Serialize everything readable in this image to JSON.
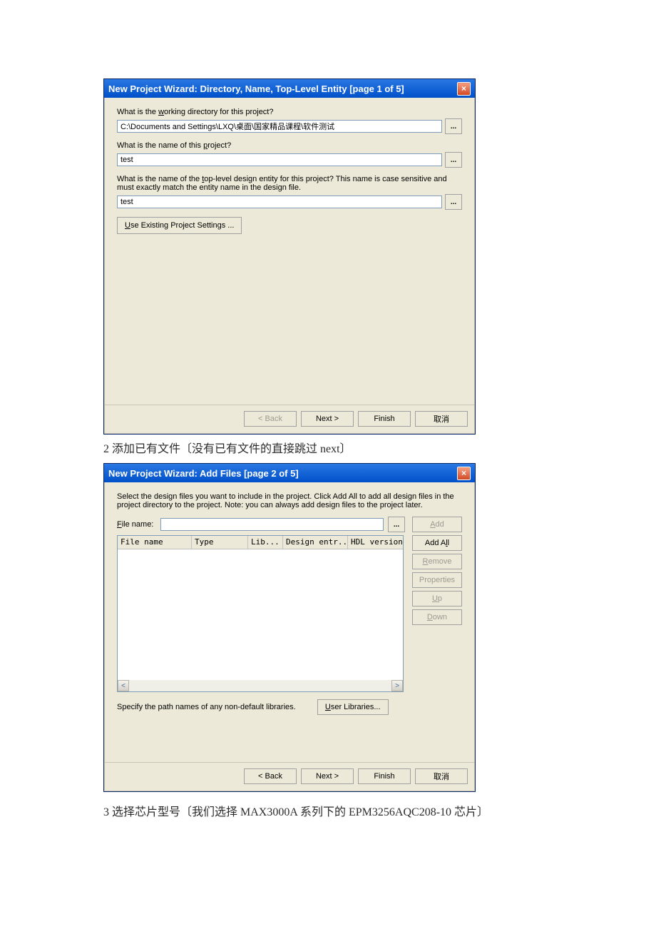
{
  "dialog1": {
    "title": "New Project Wizard: Directory, Name, Top-Level Entity [page 1 of 5]",
    "label_dir_pre": "What is the ",
    "label_dir_u": "w",
    "label_dir_post": "orking directory for this project?",
    "dir_value": "C:\\Documents and Settings\\LXQ\\桌面\\国家精品课程\\软件测试",
    "label_name_pre": "What is the name of this ",
    "label_name_u": "p",
    "label_name_post": "roject?",
    "name_value": "test",
    "label_entity_pre": "What is the name of the ",
    "label_entity_u": "t",
    "label_entity_post": "op-level design entity for this project? This name is case sensitive and must exactly match the entity name in the design file.",
    "entity_value": "test",
    "use_existing_pre": "",
    "use_existing_u": "U",
    "use_existing_post": "se Existing Project Settings ...",
    "browse": "...",
    "back": "< Back",
    "next": "Next >",
    "finish": "Finish",
    "cancel": "取消"
  },
  "caption2": "2 添加已有文件〔没有已有文件的直接跳过 next〕",
  "watermark": "",
  "dialog2": {
    "title": "New Project Wizard: Add Files [page 2 of 5]",
    "desc": "Select the design files you want to include in the project. Click Add All to add all design files in the project directory to the project. Note: you can always add design files to the project later.",
    "file_label_u": "F",
    "file_label_post": "ile name:",
    "th_file": "File name",
    "th_type": "Type",
    "th_lib": "Lib...",
    "th_design": "Design entr...",
    "th_hdl": "HDL version",
    "add_u": "A",
    "add_post": "dd",
    "addall_pre": "Add A",
    "addall_u": "l",
    "addall_post": "l",
    "remove_u": "R",
    "remove_post": "emove",
    "properties": "Properties",
    "up_u": "U",
    "up_post": "p",
    "down_u": "D",
    "down_post": "own",
    "libs_text": "Specify the path names of any non-default libraries.",
    "user_libs_u": "U",
    "user_libs_post": "ser Libraries...",
    "back": "< Back",
    "next": "Next >",
    "finish": "Finish",
    "cancel": "取消",
    "browse": "..."
  },
  "caption3": "3 选择芯片型号〔我们选择 MAX3000A 系列下的 EPM3256AQC208-10 芯片〕"
}
